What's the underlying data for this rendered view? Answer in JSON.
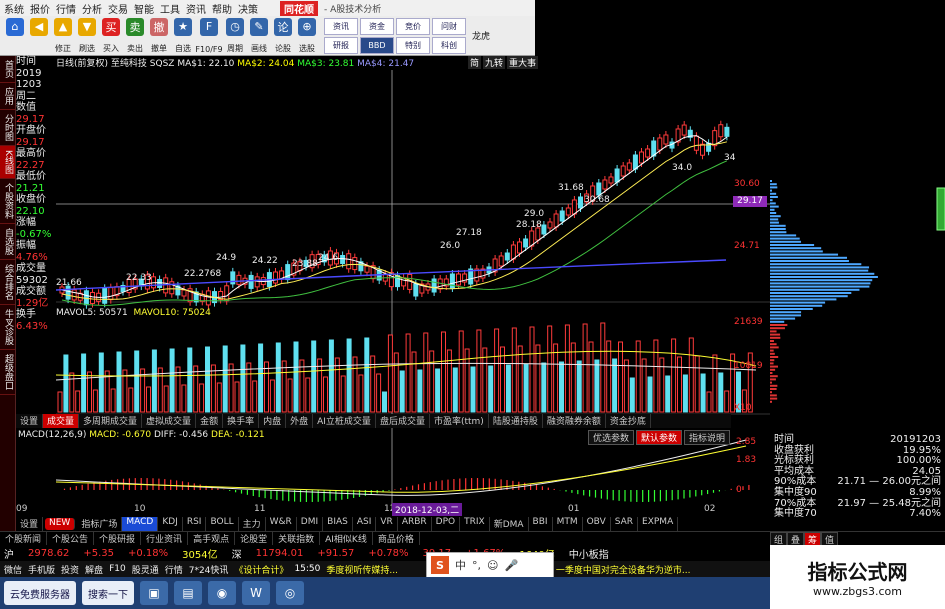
{
  "menubar": {
    "items": [
      "系统",
      "报价",
      "行情",
      "分析",
      "交易",
      "智能",
      "工具",
      "资讯",
      "帮助",
      "决策"
    ],
    "logo": "同花顺",
    "title": "- A股技术分析"
  },
  "toolbar": {
    "buttons": [
      {
        "label": "",
        "icon": "home-icon",
        "color": "#2a6ad4"
      },
      {
        "label": "",
        "icon": "back-arrow-icon",
        "color": "#e8a800"
      },
      {
        "label": "修正",
        "icon": "up-arrow-icon",
        "color": "#e8a800"
      },
      {
        "label": "刷选",
        "icon": "down-arrow-icon",
        "color": "#e8a800"
      },
      {
        "label": "买入",
        "icon": "buy-icon",
        "color": "#d22"
      },
      {
        "label": "卖出",
        "icon": "sell-icon",
        "color": "#2a8a2a"
      },
      {
        "label": "撤单",
        "icon": "cancel-order-icon",
        "color": "#c66"
      },
      {
        "label": "自选",
        "icon": "watchlist-icon",
        "color": "#36a"
      },
      {
        "label": "F10/F9",
        "icon": "f10-icon",
        "color": "#36a"
      },
      {
        "label": "周期",
        "icon": "period-icon",
        "color": "#36a"
      },
      {
        "label": "画线",
        "icon": "draw-line-icon",
        "color": "#36a"
      },
      {
        "label": "论股",
        "icon": "forum-icon",
        "color": "#36a"
      },
      {
        "label": "选股",
        "icon": "stock-picker-icon",
        "color": "#36a"
      }
    ],
    "grid": [
      {
        "label": "资讯",
        "dark": false
      },
      {
        "label": "资金",
        "dark": false
      },
      {
        "label": "竞价",
        "dark": false
      },
      {
        "label": "问财",
        "dark": false
      },
      {
        "label": "研报",
        "dark": false
      },
      {
        "label": "BBD",
        "dark": true
      },
      {
        "label": "特别",
        "dark": false
      },
      {
        "label": "科创",
        "dark": false
      }
    ],
    "extra": "龙虎"
  },
  "leftstrip": [
    {
      "label": "首页",
      "active": false
    },
    {
      "label": "应用",
      "active": false
    },
    {
      "label": "分时图",
      "active": false
    },
    {
      "label": "K线图",
      "active": true
    },
    {
      "label": "个股资料",
      "active": false
    },
    {
      "label": "自选股",
      "active": false
    },
    {
      "label": "综合排名",
      "active": false
    },
    {
      "label": "牛叉诊股",
      "active": false
    },
    {
      "label": "超级盘口",
      "active": false
    }
  ],
  "infopanel": [
    {
      "label": "时间",
      "cls": ""
    },
    {
      "label": "2019",
      "cls": ""
    },
    {
      "label": "1203",
      "cls": ""
    },
    {
      "label": "周二",
      "cls": ""
    },
    {
      "label": "数值",
      "cls": ""
    },
    {
      "label": "29.17",
      "cls": "v"
    },
    {
      "label": "开盘价",
      "cls": ""
    },
    {
      "label": "29.17",
      "cls": "v"
    },
    {
      "label": "最高价",
      "cls": ""
    },
    {
      "label": "22.27",
      "cls": "v"
    },
    {
      "label": "最低价",
      "cls": ""
    },
    {
      "label": "21.21",
      "cls": "g"
    },
    {
      "label": "收盘价",
      "cls": ""
    },
    {
      "label": "22.10",
      "cls": "g"
    },
    {
      "label": "涨幅",
      "cls": ""
    },
    {
      "label": "-0.67%",
      "cls": "g"
    },
    {
      "label": "振幅",
      "cls": ""
    },
    {
      "label": "4.76%",
      "cls": "v"
    },
    {
      "label": "成交量",
      "cls": ""
    },
    {
      "label": "59302",
      "cls": ""
    },
    {
      "label": "成交额",
      "cls": ""
    },
    {
      "label": "1.29亿",
      "cls": "v"
    },
    {
      "label": "换手",
      "cls": ""
    },
    {
      "label": "6.43%",
      "cls": "v"
    }
  ],
  "charthead": {
    "period": "日线(前复权)",
    "name": "至纯科技",
    "code": "SQSZ",
    "ma1": "MA$1: 22.10",
    "ma2": "MA$2: 24.04",
    "ma3": "MA$3: 23.81",
    "ma4": "MA$4: 21.47",
    "right": [
      "简",
      "九转",
      "重大事"
    ]
  },
  "chart_data": {
    "type": "candlestick",
    "price_axis": [
      "30.60",
      "29.17",
      "24.71"
    ],
    "annotations": [
      "21.66",
      "22.33",
      "22.2768",
      "24.9",
      "24.22",
      "23.88",
      "24.6",
      "27.18",
      "26.0",
      "29.0",
      "28.18",
      "31.68",
      "30.68",
      "34.0",
      "34"
    ],
    "vol_axis": [
      "21639",
      "10819",
      "X10"
    ]
  },
  "volhead": {
    "v1": "MAVOL5: 50571",
    "v2": "MAVOL10: 75024"
  },
  "voltabs": [
    {
      "label": "设置",
      "on": false
    },
    {
      "label": "成交量",
      "on": true
    },
    {
      "label": "多周期成交量",
      "on": false
    },
    {
      "label": "虚拟成交量",
      "on": false
    },
    {
      "label": "金额",
      "on": false
    },
    {
      "label": "换手率",
      "on": false
    },
    {
      "label": "内盘",
      "on": false
    },
    {
      "label": "外盘",
      "on": false
    },
    {
      "label": "AI立桩成交量",
      "on": false
    },
    {
      "label": "盘后成交量",
      "on": false
    },
    {
      "label": "市盈率(ttm)",
      "on": false
    },
    {
      "label": "陆股通持股",
      "on": false
    },
    {
      "label": "融资融券余额",
      "on": false
    },
    {
      "label": "资金抄底",
      "on": false
    }
  ],
  "macdtabs": [
    {
      "label": "优选参数",
      "on": false
    },
    {
      "label": "默认参数",
      "on": true
    },
    {
      "label": "指标说明",
      "on": false
    }
  ],
  "macdhead": {
    "name": "MACD(12,26,9)",
    "macd": "MACD: -0.670",
    "diff": "DIFF: -0.456",
    "dea": "DEA: -0.121"
  },
  "macd_axis": [
    "2.85",
    "1.83",
    "0"
  ],
  "dates": [
    "09",
    "10",
    "11",
    "12",
    "01",
    "02"
  ],
  "datetag": "2018-12-03,二",
  "indtabs": [
    {
      "label": "设置",
      "cls": ""
    },
    {
      "label": "NEW",
      "cls": "new"
    },
    {
      "label": "指标广场",
      "cls": ""
    },
    {
      "label": "MACD",
      "cls": "on"
    },
    {
      "label": "KDJ",
      "cls": ""
    },
    {
      "label": "RSI",
      "cls": ""
    },
    {
      "label": "BOLL",
      "cls": ""
    },
    {
      "label": "主力",
      "cls": ""
    },
    {
      "label": "W&R",
      "cls": ""
    },
    {
      "label": "DMI",
      "cls": ""
    },
    {
      "label": "BIAS",
      "cls": ""
    },
    {
      "label": "ASI",
      "cls": ""
    },
    {
      "label": "VR",
      "cls": ""
    },
    {
      "label": "ARBR",
      "cls": ""
    },
    {
      "label": "DPO",
      "cls": ""
    },
    {
      "label": "TRIX",
      "cls": ""
    },
    {
      "label": "新DMA",
      "cls": ""
    },
    {
      "label": "BBI",
      "cls": ""
    },
    {
      "label": "MTM",
      "cls": ""
    },
    {
      "label": "OBV",
      "cls": ""
    },
    {
      "label": "SAR",
      "cls": ""
    },
    {
      "label": "EXPMA",
      "cls": ""
    }
  ],
  "pagetabs": [
    "个股新闻",
    "个股公告",
    "个股研报",
    "行业资讯",
    "高手观点",
    "论股堂",
    "关联指数",
    "AI相似K线",
    "商品价格"
  ],
  "ticker": [
    {
      "text": "沪",
      "cls": "w"
    },
    {
      "text": "2978.62",
      "cls": "r"
    },
    {
      "text": "+5.35",
      "cls": "r"
    },
    {
      "text": "+0.18%",
      "cls": "r"
    },
    {
      "text": "3054亿",
      "cls": "y"
    },
    {
      "text": "深",
      "cls": "w"
    },
    {
      "text": "11794.01",
      "cls": "r"
    },
    {
      "text": "+91.57",
      "cls": "r"
    },
    {
      "text": "+0.78%",
      "cls": "r"
    },
    {
      "text": "39.17",
      "cls": "r"
    },
    {
      "text": "+1.67%",
      "cls": "r"
    },
    {
      "text": "1640亿",
      "cls": "y"
    },
    {
      "text": "中小板指",
      "cls": "w"
    }
  ],
  "statusbar": {
    "items": [
      "微信",
      "手机版",
      "投资",
      "解盘",
      "F10",
      "股灵通",
      "行情",
      "7*24快讯"
    ],
    "news1": "《设计合计》",
    "time1": "15:50",
    "news2": "季度视听传媒持...",
    "time2": "15:49",
    "news3": "一季度中国对完全设备华为逆市..."
  },
  "ime": {
    "label": "中",
    "brand": "S"
  },
  "taskbar": {
    "start": "云免费服务器",
    "search": "搜索一下"
  },
  "profile": {
    "rows": [
      {
        "k": "时间",
        "v": "20191203",
        "r": false
      },
      {
        "k": "收盘获利",
        "v": "19.95%",
        "r": false
      },
      {
        "k": "光标获利",
        "v": "100.00%",
        "r": false
      },
      {
        "k": "平均成本",
        "v": "24.05",
        "r": false
      },
      {
        "k": "90%成本",
        "v": "21.71 — 26.00元之间",
        "r": false
      },
      {
        "k": "集中度90",
        "v": "8.99%",
        "r": false
      },
      {
        "k": "70%成本",
        "v": "21.97 — 25.48元之间",
        "r": false
      },
      {
        "k": "集中度70",
        "v": "7.40%",
        "r": false
      }
    ],
    "tabs": [
      {
        "label": "组",
        "on": false
      },
      {
        "label": "叠",
        "on": false
      },
      {
        "label": "筹",
        "on": true
      },
      {
        "label": "值",
        "on": false
      }
    ]
  },
  "watermark": {
    "t1": "指标公式网",
    "t2": "www.zbgs3.com"
  },
  "colors": {
    "up": "#ff3b3b",
    "down": "#5fe0f0",
    "ma1": "#ffffff",
    "ma2": "#ffee55",
    "ma3": "#40c040",
    "ma4": "#4a4aff"
  }
}
